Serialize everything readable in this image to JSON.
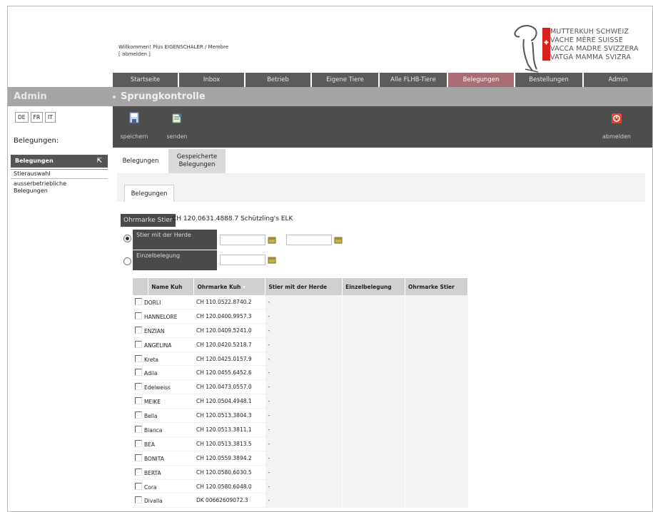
{
  "header": {
    "welcome_line": "Willkommen! Plus EIGENSCHALER / Membre",
    "logout_link": "[ abmelden ]"
  },
  "logo": {
    "lines": [
      "MUTTERKUH SCHWEIZ",
      "VACHE MÈRE SUISSE",
      "VACCA MADRE SVIZZERA",
      "VATGA MAMMA SVIZRA"
    ],
    "flag_color": "#d8201f"
  },
  "nav": {
    "tabs": [
      "Startseite",
      "Inbox",
      "Betrieb",
      "Eigene Tiere",
      "Alle FLHB-Tiere",
      "Belegungen",
      "Bestellungen",
      "Admin"
    ],
    "active": "Belegungen"
  },
  "band": {
    "admin": "Admin",
    "title": "Sprungkontrolle"
  },
  "toolbar": {
    "save": "speichern",
    "send": "senden",
    "logout": "abmelden"
  },
  "sidebar": {
    "languages": [
      "DE",
      "FR",
      "IT"
    ],
    "label": "Belegungen:",
    "section": "Belegungen",
    "items": [
      "Stierauswahl",
      "ausserbetriebliche",
      "Belegungen"
    ]
  },
  "subtabs": {
    "first": "Belegungen",
    "second_1": "Gespeicherte",
    "second_2": "Belegungen"
  },
  "form": {
    "tab": "Belegungen",
    "ohrmarke_label": "Ohrmarke Stier",
    "ohrmarke_value": "CH 120.0631.4888.7 Schützling's ELK",
    "option1": "Stier mit der Herde",
    "option2": "Einzelbelegung"
  },
  "table": {
    "headers": [
      "Name Kuh",
      "Ohrmarke Kuh",
      "Stier mit der Herde",
      "Einzelbelegung",
      "Ohrmarke Stier"
    ],
    "rows": [
      {
        "name": "DORLI",
        "ear": "CH 110.0522.8740.2",
        "herd": "-"
      },
      {
        "name": "HANNELORE",
        "ear": "CH 120.0400.9957.3",
        "herd": "-"
      },
      {
        "name": "ENZIAN",
        "ear": "CH 120.0409.5241.0",
        "herd": "-"
      },
      {
        "name": "ANGELINA",
        "ear": "CH 120.0420.5218.7",
        "herd": "-"
      },
      {
        "name": "Kreta",
        "ear": "CH 120.0425.0157.9",
        "herd": "-"
      },
      {
        "name": "Adila",
        "ear": "CH 120.0455.6452.6",
        "herd": "-"
      },
      {
        "name": "Edelweiss",
        "ear": "CH 120.0473.0557.0",
        "herd": "-"
      },
      {
        "name": "MEIKE",
        "ear": "CH 120.0504.4948.1",
        "herd": "-"
      },
      {
        "name": "Bella",
        "ear": "CH 120.0513.3804.3",
        "herd": "-"
      },
      {
        "name": "Bianca",
        "ear": "CH 120.0513.3811.1",
        "herd": "-"
      },
      {
        "name": "BEA",
        "ear": "CH 120.0513.3813.5",
        "herd": "-"
      },
      {
        "name": "BONITA",
        "ear": "CH 120.0559.3894.2",
        "herd": "-"
      },
      {
        "name": "BERTA",
        "ear": "CH 120.0580.6030.5",
        "herd": "-"
      },
      {
        "name": "Cora",
        "ear": "CH 120.0580.6048.0",
        "herd": "-"
      },
      {
        "name": "Divalla",
        "ear": "DK 00662609072.3",
        "herd": "-"
      }
    ]
  }
}
